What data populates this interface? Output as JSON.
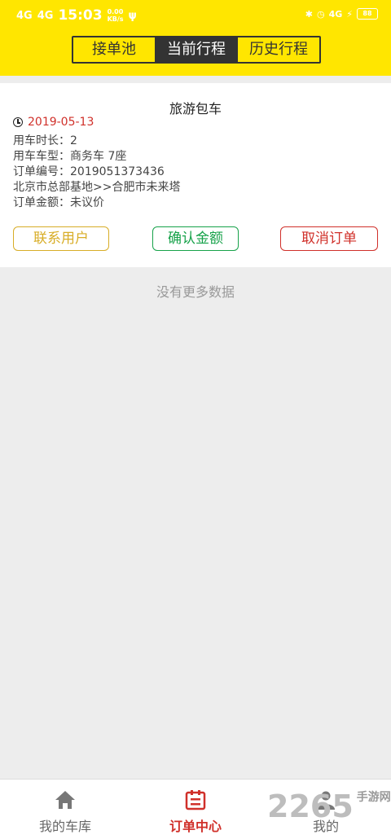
{
  "status_bar": {
    "net1": "4G",
    "net2": "4G",
    "time": "15:03",
    "speed_value": "0.00",
    "speed_unit": "KB/s",
    "right_net": "4G",
    "battery": "88"
  },
  "segment": {
    "tabs": [
      {
        "label": "接单池",
        "active": false
      },
      {
        "label": "当前行程",
        "active": true
      },
      {
        "label": "历史行程",
        "active": false
      }
    ]
  },
  "order": {
    "title": "旅游包车",
    "date": "2019-05-13",
    "duration": "用车时长：2",
    "vehicle": "用车车型：商务车 7座",
    "order_no": "订单编号：2019051373436",
    "route": "北京市总部基地>>合肥市未来塔",
    "amount": "订单金额：未议价",
    "actions": {
      "contact": "联系用户",
      "confirm": "确认金额",
      "cancel": "取消订单"
    }
  },
  "list": {
    "no_more": "没有更多数据"
  },
  "tabbar": {
    "items": [
      {
        "label": "我的车库",
        "icon": "home-icon"
      },
      {
        "label": "订单中心",
        "icon": "calendar-icon",
        "active": true
      },
      {
        "label": "我的",
        "icon": "user-icon"
      }
    ]
  },
  "watermark": {
    "text": "2265",
    "sub": "手游网"
  },
  "colors": {
    "brand_yellow": "#ffe600",
    "danger_red": "#d0302a",
    "success_green": "#17a24a",
    "gold": "#d8ad27"
  }
}
